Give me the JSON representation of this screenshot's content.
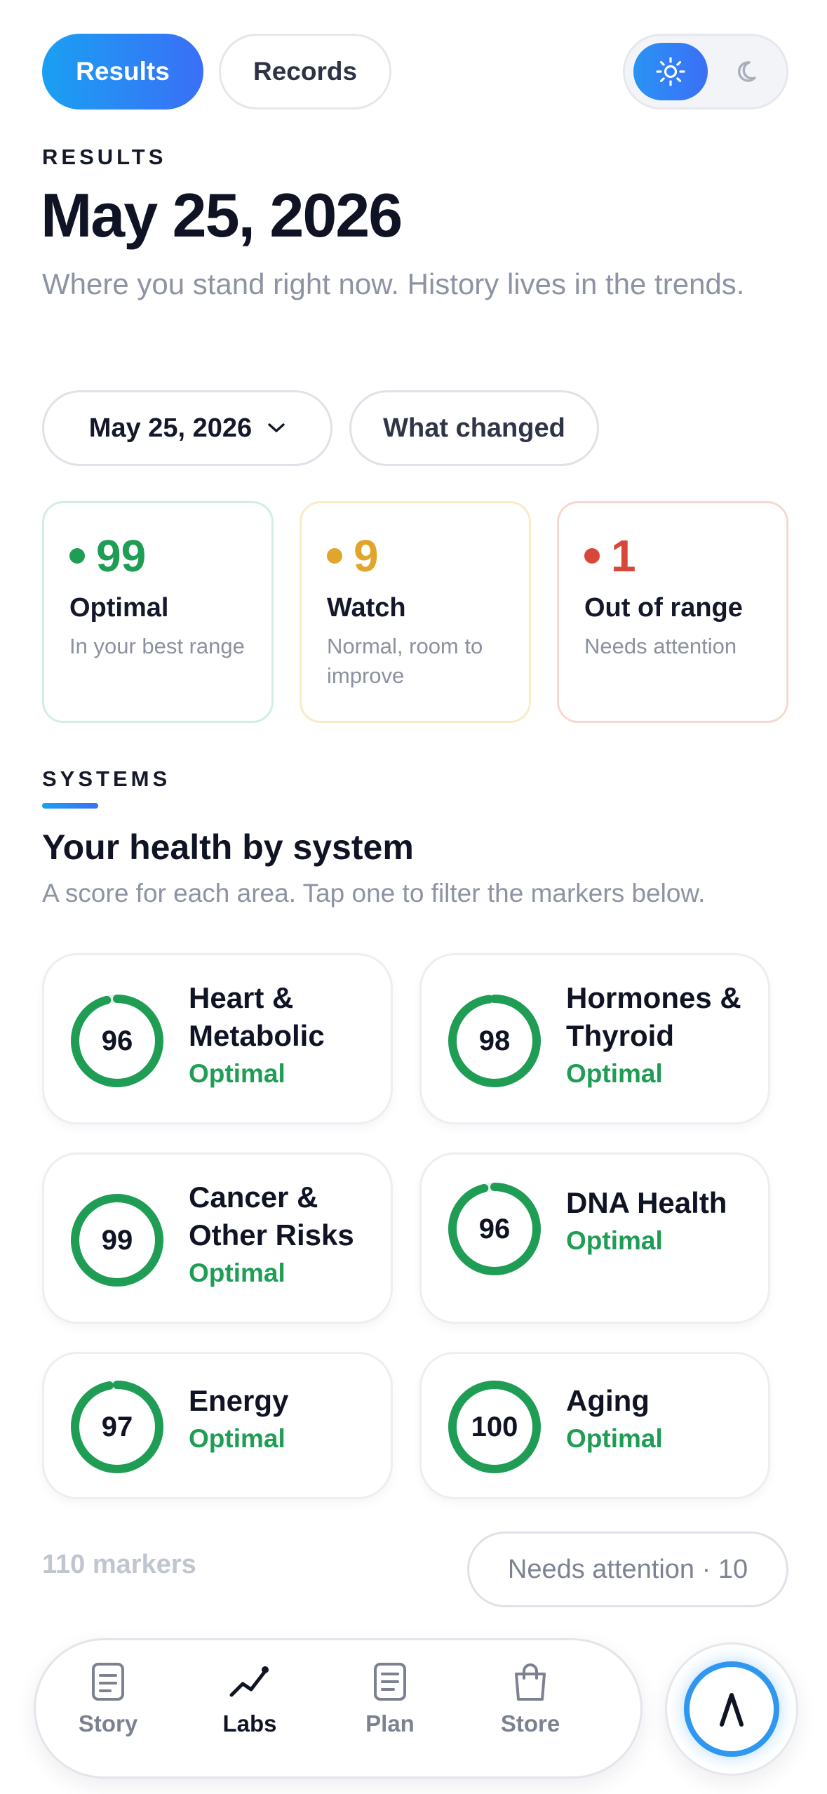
{
  "tabs": {
    "results_label": "Results",
    "records_label": "Records"
  },
  "theme_toggle": {
    "selected": "light",
    "light_icon": "sun-icon",
    "dark_icon": "moon-icon"
  },
  "header": {
    "eyebrow": "RESULTS",
    "title": "May 25, 2026",
    "subtitle": "Where you stand right now. History lives in the trends."
  },
  "filters": {
    "date_value": "May 25, 2026",
    "what_changed_label": "What changed"
  },
  "summary": [
    {
      "count": "99",
      "label": "Optimal",
      "description": "In your best range",
      "color": "#1f9d55"
    },
    {
      "count": "9",
      "label": "Watch",
      "description": "Normal, room to improve",
      "color": "#e0a52a"
    },
    {
      "count": "1",
      "label": "Out of range",
      "description": "Needs attention",
      "color": "#d9473a"
    }
  ],
  "systems": {
    "eyebrow": "SYSTEMS",
    "title": "Your health by system",
    "subtitle": "A score for each area. Tap one to filter the markers below.",
    "items": [
      {
        "score": "96",
        "name": "Heart & Metabolic",
        "status": "Optimal"
      },
      {
        "score": "98",
        "name": "Hormones & Thyroid",
        "status": "Optimal"
      },
      {
        "score": "99",
        "name": "Cancer & Other Risks",
        "status": "Optimal"
      },
      {
        "score": "96",
        "name": "DNA Health",
        "status": "Optimal"
      },
      {
        "score": "97",
        "name": "Energy",
        "status": "Optimal"
      },
      {
        "score": "100",
        "name": "Aging",
        "status": "Optimal"
      }
    ]
  },
  "markers": {
    "count_label": "110 markers",
    "needs_attention_label": "Needs attention · 10"
  },
  "nav": {
    "items": [
      {
        "label": "Story",
        "icon": "document-icon"
      },
      {
        "label": "Labs",
        "icon": "trend-icon"
      },
      {
        "label": "Plan",
        "icon": "list-icon"
      },
      {
        "label": "Store",
        "icon": "bag-icon"
      }
    ],
    "active": "Labs"
  },
  "colors": {
    "accent": "#2f80f5",
    "optimal": "#1f9d55",
    "watch": "#e0a52a",
    "out_of_range": "#d9473a"
  }
}
